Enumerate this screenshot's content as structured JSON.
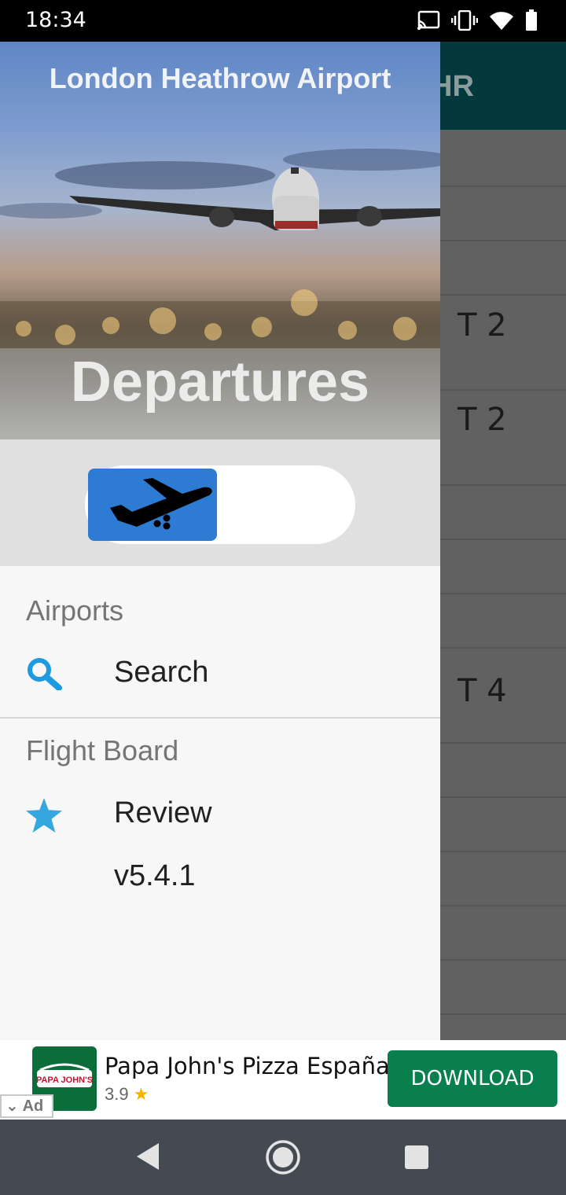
{
  "status_bar": {
    "time": "18:34",
    "icons": [
      "cast-icon",
      "vibrate-icon",
      "wifi-icon",
      "battery-icon"
    ]
  },
  "background_app": {
    "toolbar_title_fragment": "HR",
    "terminals": [
      "T 2",
      "T 2",
      "T 4"
    ]
  },
  "drawer": {
    "header": {
      "title": "London Heathrow Airport",
      "subtitle": "Departures",
      "toggle_state": "departures"
    },
    "sections": [
      {
        "header": "Airports",
        "items": [
          {
            "label": "Search",
            "icon": "search-icon"
          }
        ]
      },
      {
        "header": "Flight Board",
        "items": [
          {
            "label": "Review",
            "icon": "star-icon"
          },
          {
            "label": "v5.4.1",
            "icon": ""
          }
        ]
      }
    ]
  },
  "ad": {
    "advertiser_logo_text": "PAPA JOHN'S",
    "title": "Papa John's Pizza España",
    "rating": "3.9",
    "button_label": "DOWNLOAD",
    "badge_label": "Ad"
  },
  "colors": {
    "toolbar": "#03383d",
    "accent_blue": "#2d7bd2",
    "icon_blue": "#1e9ae0",
    "download_green": "#0a7f4e"
  }
}
